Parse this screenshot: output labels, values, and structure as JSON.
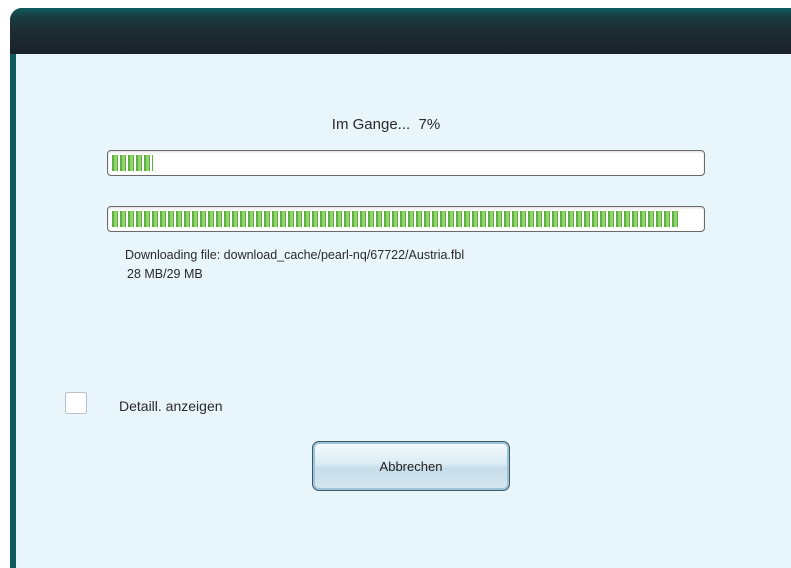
{
  "status": {
    "label": "Im Gange...",
    "percent_text": "7%"
  },
  "progress": {
    "overall_fraction": 0.07,
    "file_fraction": 0.965
  },
  "download": {
    "file_text": "Downloading file: download_cache/pearl-nq/67722/Austria.fbl",
    "size_text": "28 MB/29 MB"
  },
  "details_checkbox": {
    "label": "Detaill. anzeigen",
    "checked": false
  },
  "cancel_button": {
    "label": "Abbrechen"
  },
  "colors": {
    "progress_green": "#5fb044",
    "client_background": "#e8f5fb",
    "titlebar": "#1e2c33"
  }
}
